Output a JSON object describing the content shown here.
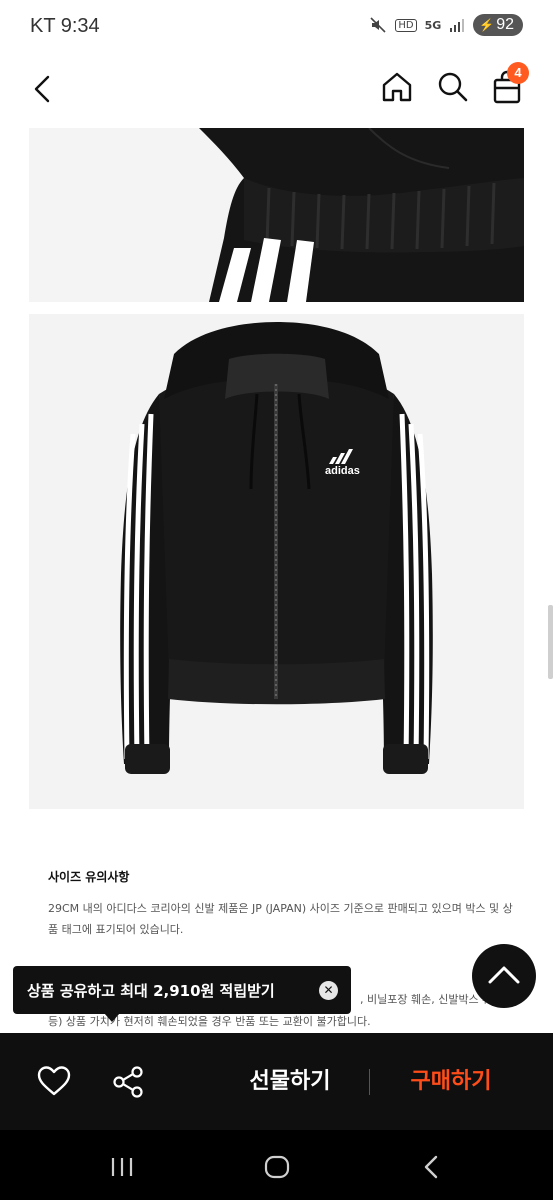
{
  "status_bar": {
    "carrier_time": "KT 9:34",
    "hd_label": "HD",
    "network_label": "5G",
    "battery_level": "92"
  },
  "header": {
    "cart_count": "4"
  },
  "size_notice": {
    "title": "사이즈 유의사항",
    "body": "29CM 내의 아디다스 코리아의 신발 제품은 JP (JAPAN) 사이즈 기준으로 판매되고 있으며 박스 및 상품 태그에 표기되어 있습니다."
  },
  "return_notice": {
    "line_fragment_right": ", 비닐포장 훼손, 신발박스 훼손",
    "line_bottom": "등) 상품 가치가 현저히 훼손되었을 경우 반품 또는 교환이 불가합니다."
  },
  "toast": {
    "message": "상품 공유하고 최대 2,910원 적립받기",
    "close_symbol": "✕"
  },
  "actions": {
    "gift_label": "선물하기",
    "buy_label": "구매하기"
  },
  "colors": {
    "accent": "#ff4d1a",
    "badge": "#ff5a1f",
    "bar_bg": "#0f0f0f"
  }
}
